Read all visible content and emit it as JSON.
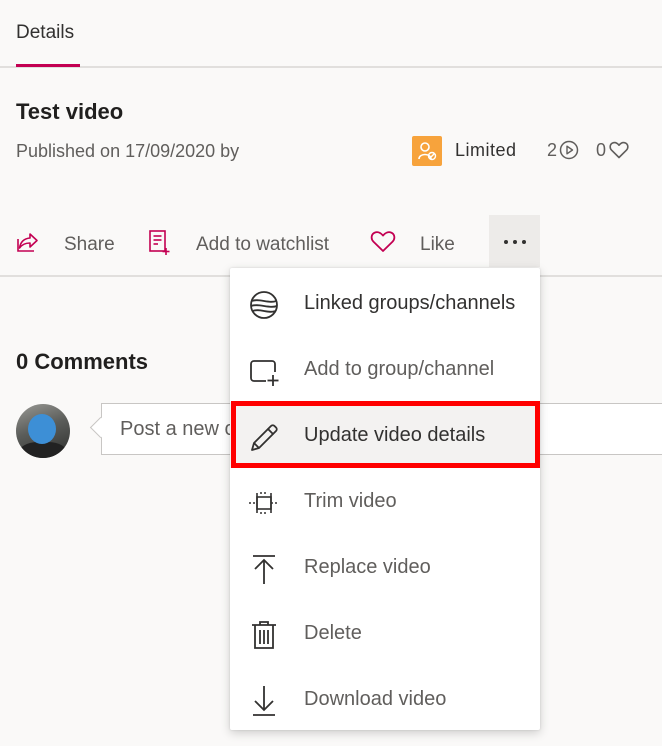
{
  "tabs": {
    "details_label": "Details"
  },
  "video": {
    "title": "Test video",
    "published_text": "Published on 17/09/2020 by",
    "permission_label": "Limited",
    "views_count": "2",
    "likes_count": "0"
  },
  "actions": {
    "share_label": "Share",
    "watchlist_label": "Add to watchlist",
    "like_label": "Like",
    "more_icon": "more-horizontal-icon"
  },
  "comments": {
    "heading": "0 Comments",
    "input_placeholder": "Post a new comment"
  },
  "menu": {
    "items": [
      {
        "label": "Linked groups/channels",
        "icon": "linked-groups-icon"
      },
      {
        "label": "Add to group/channel",
        "icon": "add-group-icon"
      },
      {
        "label": "Update video details",
        "icon": "pencil-icon"
      },
      {
        "label": "Trim video",
        "icon": "trim-icon"
      },
      {
        "label": "Replace video",
        "icon": "upload-arrow-icon"
      },
      {
        "label": "Delete",
        "icon": "trash-icon"
      },
      {
        "label": "Download video",
        "icon": "download-arrow-icon"
      }
    ]
  },
  "colors": {
    "accent": "#c30052",
    "badge": "#f7a33c",
    "highlight": "#ff0000"
  }
}
